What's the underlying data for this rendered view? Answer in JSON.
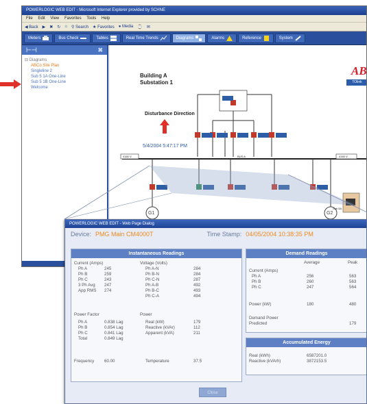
{
  "browser": {
    "title": "POWERLOGIC WEB EDIT - Microsoft Internet Explorer provided by SCHNE",
    "menu": [
      "File",
      "Edit",
      "View",
      "Favorites",
      "Tools",
      "Help"
    ],
    "toolbar": [
      "Back",
      "Search",
      "Favorites",
      "Media"
    ],
    "nav_tabs": [
      {
        "label": "Meters",
        "icon": "meter-icon"
      },
      {
        "label": "Bus Check",
        "icon": "bus-icon"
      },
      {
        "label": "Tables",
        "icon": "table-icon"
      },
      {
        "label": "Real Time Trends",
        "icon": "trend-icon"
      },
      {
        "label": "Diagrams",
        "icon": "diagram-icon"
      },
      {
        "label": "Alarms",
        "icon": "alarm-icon"
      },
      {
        "label": "Reference",
        "icon": "reference-icon"
      },
      {
        "label": "System",
        "icon": "wrench-icon"
      }
    ]
  },
  "tree": {
    "root": "Diagrams",
    "items": [
      "ABCo Site Plan",
      "Singleline 2",
      "Sub 5 1A One-Line",
      "Sub 5 1B One-Line",
      "Welcome"
    ],
    "selected": 0
  },
  "diagram": {
    "title_line1": "Building A",
    "title_line2": "Substation 1",
    "logo": "ABC",
    "logo_button": "TOlink",
    "disturbance": "Disturbance Direction",
    "timestamp": "5/4/2004 5:47:17 PM",
    "gen1": "G1",
    "gen2": "G2",
    "bus_left": "4160 V",
    "bus_right": "4160 V",
    "bus_mid": "BUS A",
    "sub_label": "Sub 5A"
  },
  "popup": {
    "title": "POWERLOGIC WEB EDIT - Web Page Dialog",
    "device_label": "Device:",
    "device_value": "PMG Main CM4000T",
    "time_label": "Time Stamp:",
    "time_value": "04/05/2004 10:38:35 PM",
    "inst": {
      "heading": "Instantaneous Readings",
      "current_heading": "Current (Amps)",
      "current": [
        {
          "label": "Ph A",
          "value": "245"
        },
        {
          "label": "Ph B",
          "value": "259"
        },
        {
          "label": "Ph C",
          "value": "243"
        },
        {
          "label": "3 Ph Avg",
          "value": "247"
        },
        {
          "label": "App RMS",
          "value": "274"
        }
      ],
      "voltage_heading": "Voltage (Volts)",
      "voltage": [
        {
          "label": "Ph A-N",
          "value": "284"
        },
        {
          "label": "Ph B-N",
          "value": "284"
        },
        {
          "label": "Ph C-N",
          "value": "287"
        },
        {
          "label": "Ph A-B",
          "value": "492"
        },
        {
          "label": "Ph B-C",
          "value": "493"
        },
        {
          "label": "Ph C-A",
          "value": "494"
        }
      ],
      "pf_heading": "Power Factor",
      "pf": [
        {
          "label": "Ph A",
          "value": "0.838 Lag"
        },
        {
          "label": "Ph B",
          "value": "0.854 Lag"
        },
        {
          "label": "Ph C",
          "value": "0.841 Lag"
        },
        {
          "label": "Total",
          "value": "0.849 Lag"
        }
      ],
      "power_heading": "Power",
      "power": [
        {
          "label": "Real (kW)",
          "value": "179"
        },
        {
          "label": "Reactive (kVAr)",
          "value": "112"
        },
        {
          "label": "Apparent (kVA)",
          "value": "211"
        }
      ],
      "freq_label": "Frequency",
      "freq_value": "60.00",
      "temp_label": "Temperature",
      "temp_value": "37.5"
    },
    "demand": {
      "heading": "Demand Readings",
      "col_avg": "Average",
      "col_peak": "Peak",
      "current_heading": "Current (Amps)",
      "rows": [
        {
          "label": "Ph A",
          "avg": "256",
          "peak": "563"
        },
        {
          "label": "Ph B",
          "avg": "260",
          "peak": "563"
        },
        {
          "label": "Ph C",
          "avg": "247",
          "peak": "564"
        }
      ],
      "power_label": "Power (kW)",
      "power_avg": "180",
      "power_peak": "480",
      "predicted_label1": "Demand Power",
      "predicted_label2": "Predicted",
      "predicted_value": "179"
    },
    "energy": {
      "heading": "Accumulated Energy",
      "real_label": "Real (kWh)",
      "real_value": "6587201.0",
      "reactive_label": "Reactive (kVArh)",
      "reactive_value": "3872153.5"
    },
    "close": "Close"
  },
  "colors": {
    "nav_blue": "#2a4f9c",
    "panel_head": "#5d7fc4",
    "accent_orange": "#f08a1e",
    "breaker_red": "#c0392b",
    "arrow_red": "#e0302a"
  }
}
